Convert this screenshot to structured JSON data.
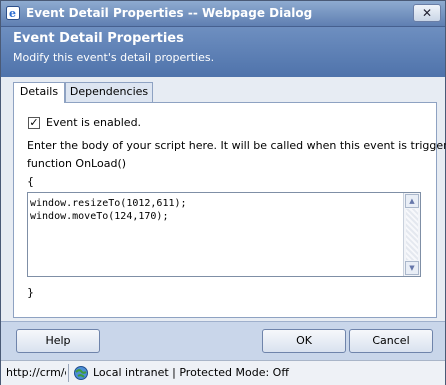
{
  "window": {
    "title": "Event Detail Properties -- Webpage Dialog",
    "close_label": "✕"
  },
  "header": {
    "title": "Event Detail Properties",
    "subtitle": "Modify this event's detail properties."
  },
  "tabs": [
    {
      "label": "Details",
      "active": true
    },
    {
      "label": "Dependencies",
      "active": false
    }
  ],
  "details": {
    "enabled_checked": true,
    "enabled_label": "Event is enabled.",
    "instructions": "Enter the body of your script here. It will be called when this event is triggered.",
    "function_signature": "function OnLoad()",
    "open_brace": "{",
    "close_brace": "}",
    "script_lines": [
      "window.resizeTo(1012,611);",
      "window.moveTo(124,170);"
    ]
  },
  "buttons": {
    "help": "Help",
    "ok": "OK",
    "cancel": "Cancel"
  },
  "statusbar": {
    "url": "http://crm/cı",
    "zone": "Local intranet | Protected Mode: Off"
  }
}
